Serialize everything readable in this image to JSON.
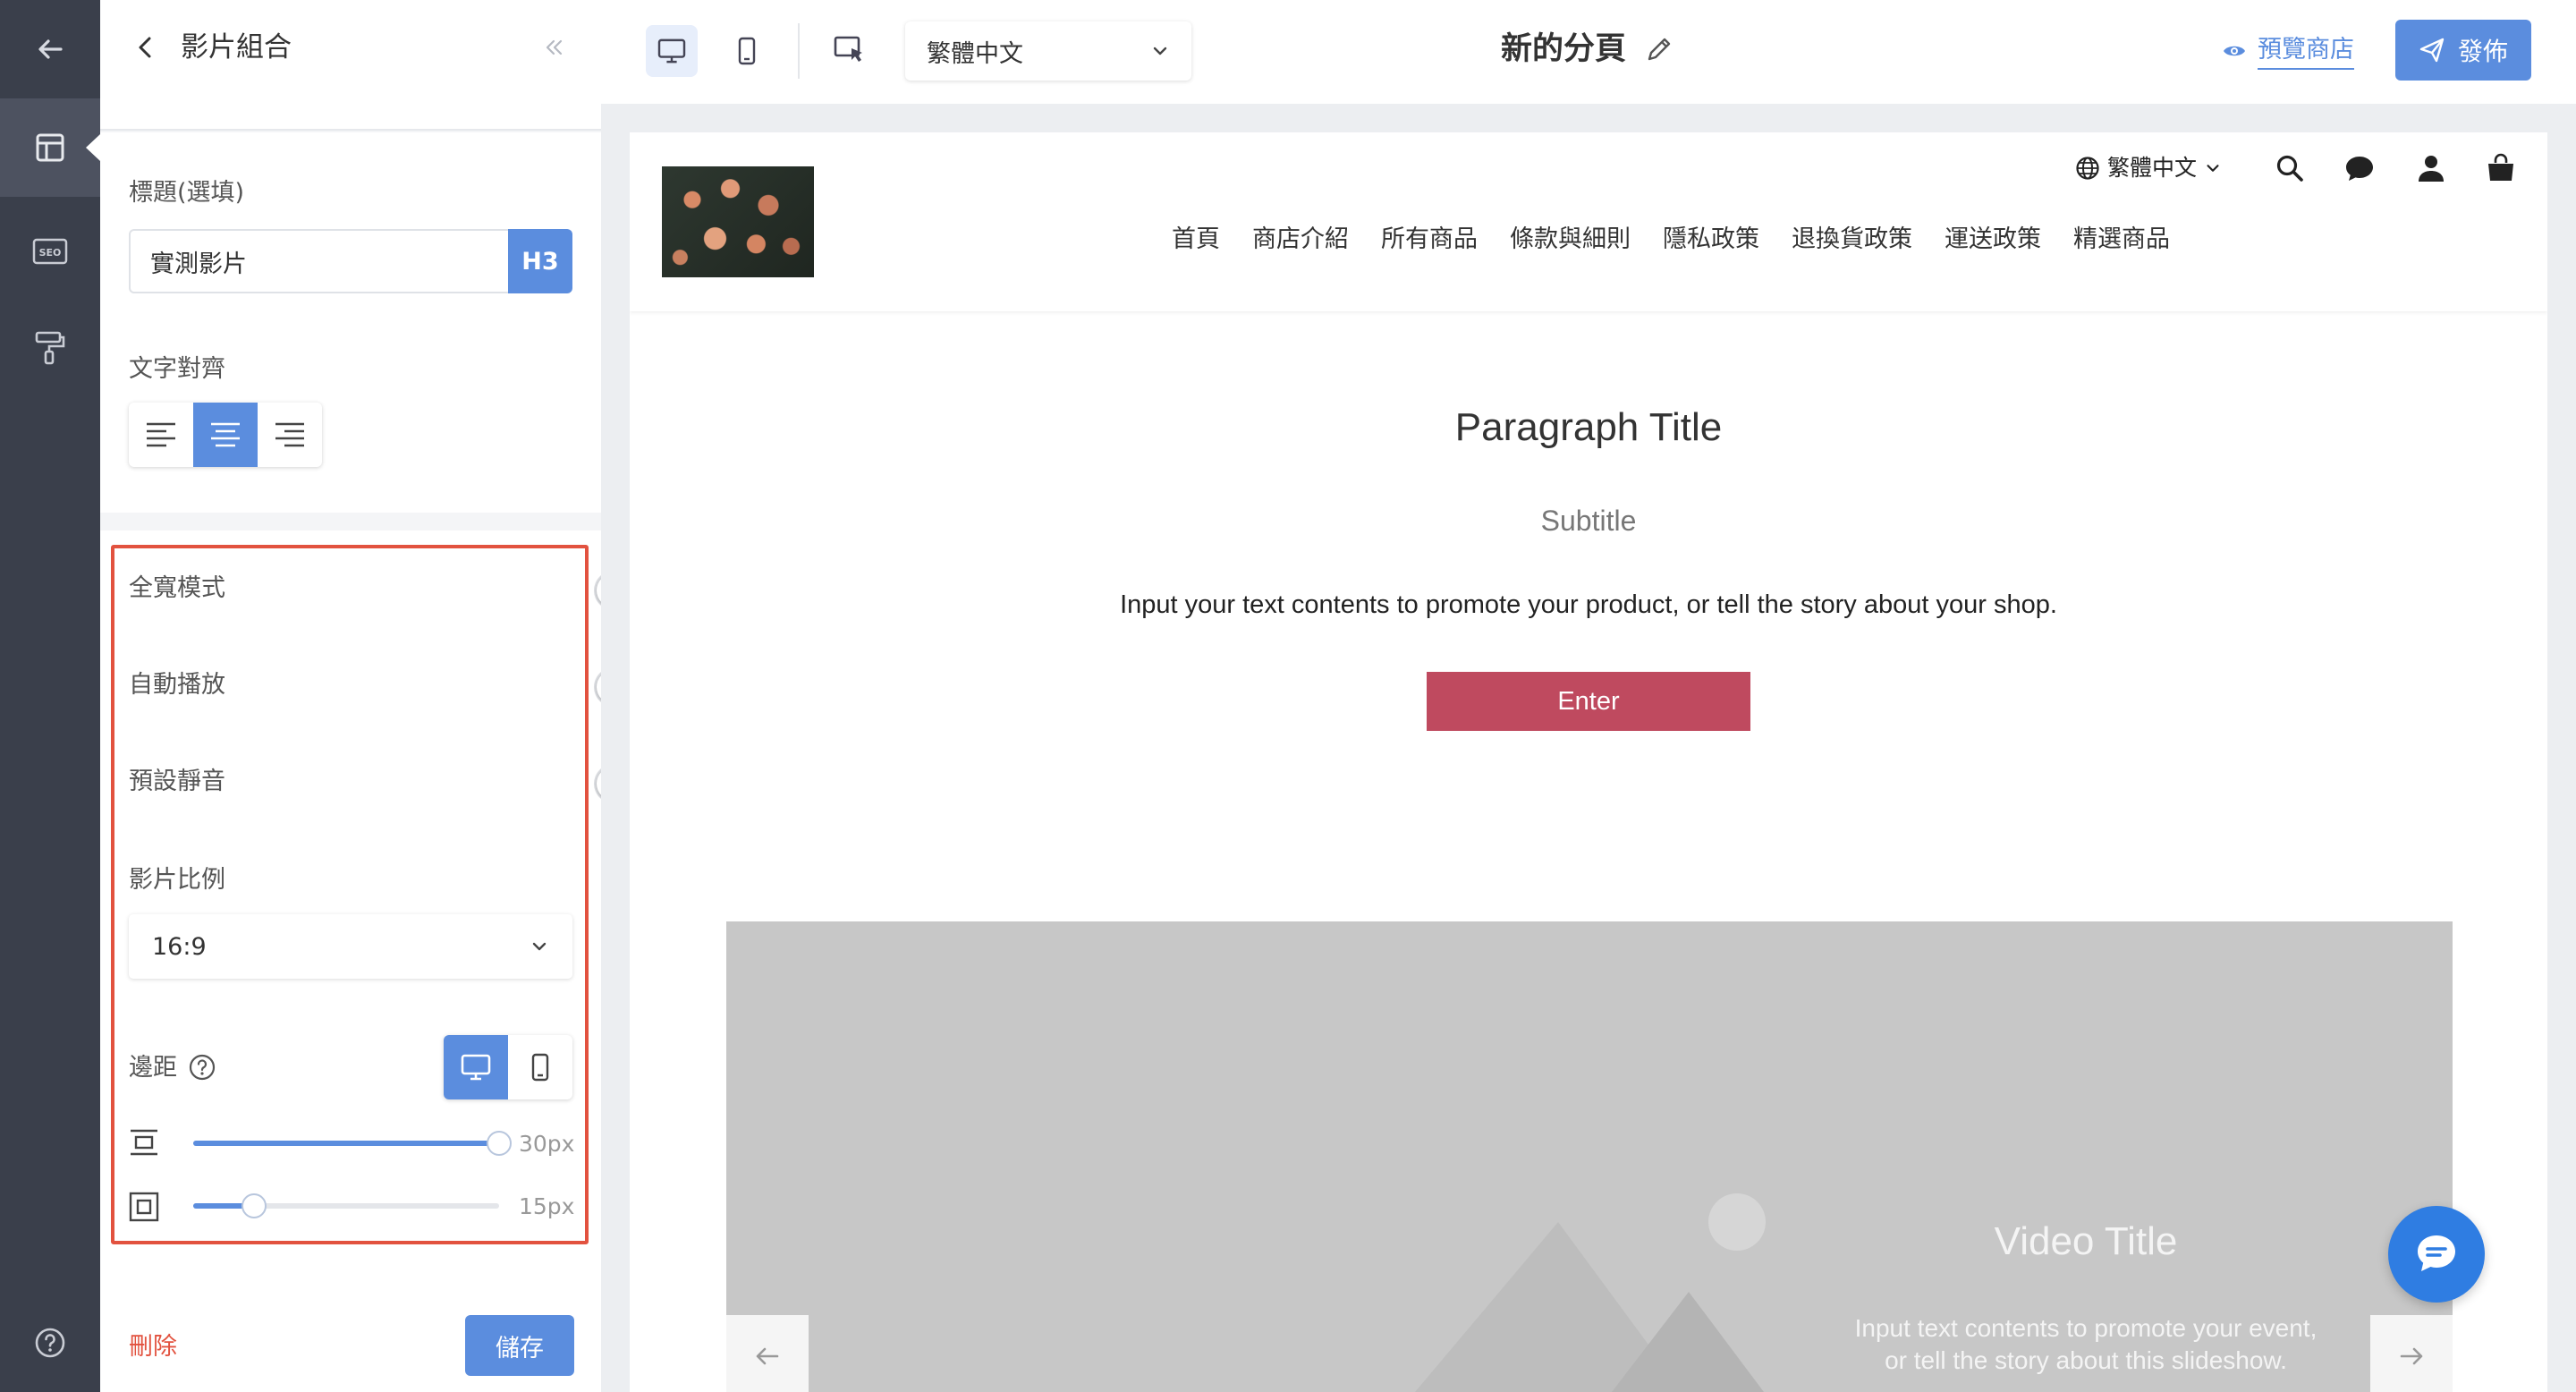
{
  "panel": {
    "title": "影片組合",
    "title_field": {
      "label": "標題(選填)",
      "value": "實測影片",
      "heading_tag": "H3"
    },
    "text_align": {
      "label": "文字對齊",
      "options": [
        "left",
        "center",
        "right"
      ],
      "selected": "center"
    },
    "toggles": [
      {
        "label": "全寬模式",
        "on": false
      },
      {
        "label": "自動播放",
        "on": false
      },
      {
        "label": "預設靜音",
        "on": false
      }
    ],
    "aspect_ratio": {
      "label": "影片比例",
      "value": "16:9"
    },
    "padding": {
      "label": "邊距",
      "device_selected": "desktop",
      "vertical": {
        "value_text": "30px",
        "fraction": 1.0
      },
      "horizontal": {
        "value_text": "15px",
        "fraction": 0.2
      }
    },
    "delete_label": "刪除",
    "save_label": "儲存"
  },
  "topbar": {
    "language": "繁體中文",
    "page_name": "新的分頁",
    "preview_label": "預覽商店",
    "publish_label": "發佈"
  },
  "site": {
    "language": "繁體中文",
    "nav": [
      "首頁",
      "商店介紹",
      "所有商品",
      "條款與細則",
      "隱私政策",
      "退換貨政策",
      "運送政策",
      "精選商品"
    ],
    "paragraph_title": "Paragraph Title",
    "subtitle": "Subtitle",
    "body": "Input your text contents to promote your product, or tell the story about your shop.",
    "button_label": "Enter",
    "slideshow": {
      "title": "Video Title",
      "text_line1": "Input text contents to promote your event,",
      "text_line2": "or tell the story about this slideshow."
    }
  },
  "colors": {
    "accent": "#5b8dde",
    "rail": "#3a3f4b",
    "highlight": "#e2523f",
    "enter_button": "#bf4a5f",
    "chat_fab": "#2f7de2"
  },
  "icons": [
    "back-arrow-icon",
    "layout-icon",
    "seo-icon",
    "paint-roller-icon",
    "help-icon",
    "chevron-left-icon",
    "double-chevron-left-icon",
    "desktop-icon",
    "mobile-icon",
    "cursor-select-icon",
    "chevron-down-icon",
    "pencil-icon",
    "eye-icon",
    "send-icon",
    "globe-icon",
    "search-icon",
    "chat-bubble-icon",
    "user-icon",
    "shopping-bag-icon",
    "arrow-left-icon",
    "arrow-right-icon"
  ]
}
